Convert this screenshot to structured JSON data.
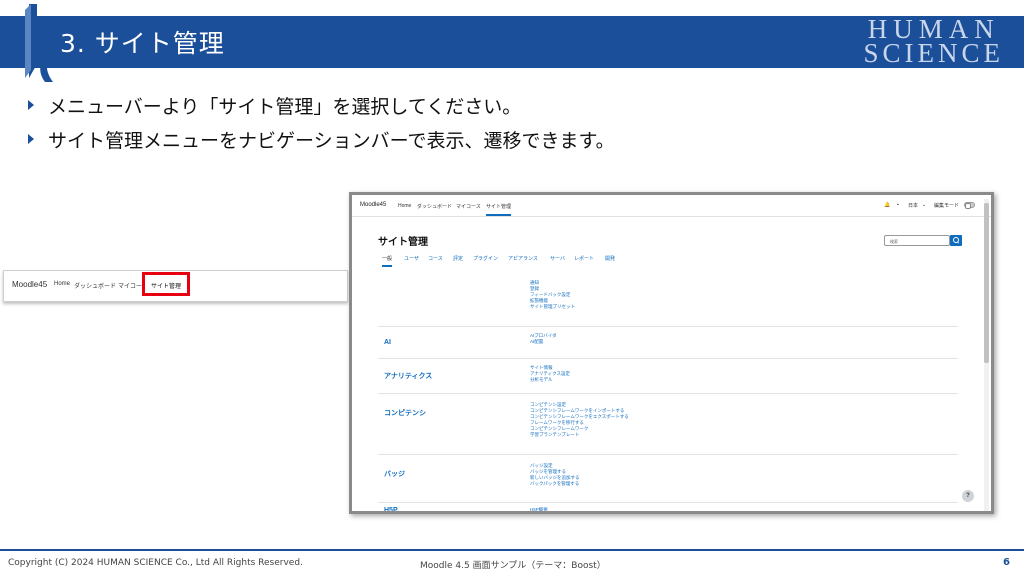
{
  "slide": {
    "title": "3. サイト管理",
    "brand_line1": "HUMAN",
    "brand_line2": "SCIENCE",
    "bullets": [
      "メニューバーより「サイト管理」を選択してください。",
      "サイト管理メニューをナビゲーションバーで表示、遷移できます。"
    ],
    "colors": {
      "banner": "#1b4f9a",
      "highlight": "#e60012",
      "link": "#0f6cbf"
    }
  },
  "small_nav": {
    "site_name": "Moodle45",
    "items": [
      "Home",
      "ダッシュボード",
      "マイコー"
    ],
    "highlighted": "サイト管理"
  },
  "screen": {
    "site_name": "Moodle45",
    "nav": [
      "Home",
      "ダッシュボード",
      "マイコース",
      "サイト管理"
    ],
    "lang": "日本",
    "lang_chevron": "⌄",
    "edit_mode": "編集モード",
    "page_title": "サイト管理",
    "search_placeholder": "検索",
    "tabs": [
      "一般",
      "ユーザ",
      "コース",
      "評定",
      "プラグイン",
      "アピアランス",
      "サーバ",
      "レポート",
      "開発"
    ],
    "sections": [
      {
        "heading": "",
        "links": [
          "通知",
          "登録",
          "フィードバック設定",
          "拡張機能",
          "サイト管理プリセット"
        ]
      },
      {
        "heading": "AI",
        "links": [
          "AIプロバイダ",
          "AI配置"
        ]
      },
      {
        "heading": "アナリティクス",
        "links": [
          "サイト情報",
          "アナリティクス設定",
          "分析モデル"
        ]
      },
      {
        "heading": "コンピテンシ",
        "links": [
          "コンピテンシ設定",
          "コンピテンシフレームワークをインポートする",
          "コンピテンシフレームワークをエクスポートする",
          "フレームワークを移行する",
          "コンピテンシフレームワーク",
          "学習プランテンプレート"
        ]
      },
      {
        "heading": "バッジ",
        "links": [
          "バッジ設定",
          "バッジを管理する",
          "新しいバッジを追加する",
          "バックパックを管理する"
        ]
      },
      {
        "heading": "H5P",
        "links": [
          "H5P概要"
        ]
      }
    ],
    "help": "?"
  },
  "footer": {
    "copyright": "Copyright (C) 2024 HUMAN SCIENCE Co., Ltd All Rights Reserved.",
    "center": "Moodle 4.5 画面サンプル（テーマ：Boost）",
    "page": "6"
  }
}
